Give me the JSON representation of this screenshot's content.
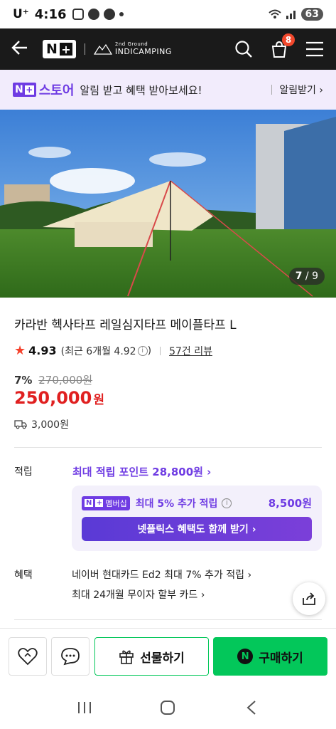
{
  "status_bar": {
    "carrier": "U⁺",
    "time": "4:16",
    "battery": "63"
  },
  "header": {
    "back_icon": "arrow-left-icon",
    "logo_n": "N",
    "logo_plus": "+",
    "brand_small": "2nd Ground",
    "brand_name": "INDICAMPING",
    "cart_count": "8"
  },
  "banner": {
    "store_label": "스토어",
    "text": "알림 받고 혜택 받아보세요!",
    "action": "알림받기 ›"
  },
  "hero": {
    "counter_current": "7",
    "counter_total": "/ 9"
  },
  "product": {
    "title": "카라반 헥사타프 레일심지타프 메이플타프 L",
    "rating": "4.93",
    "recent_rating": "(최근 6개월 4.92",
    "recent_close": ")",
    "reviews": "57건 리뷰",
    "discount_pct": "7%",
    "original_price": "270,000원",
    "price": "250,000",
    "price_unit": "원",
    "shipping": "3,000원"
  },
  "points": {
    "label": "적립",
    "max_text": "최대 적립 포인트 28,800원 ›",
    "membership_badge": "멤버십",
    "extra_text": "최대 5% 추가 적립",
    "extra_amount": "8,500원",
    "netflix_button": "넷플릭스 혜택도 함께 받기 ›"
  },
  "benefits": {
    "label": "혜택",
    "line1": "네이버 현대카드 Ed2 최대 7% 추가 적립 ›",
    "line2": "최대 24개월 무이자 할부 카드 ›"
  },
  "actions": {
    "gift_label": "선물하기",
    "buy_label": "구매하기",
    "buy_n": "N"
  },
  "colors": {
    "accent_purple": "#6f3ce3",
    "naver_green": "#03c75a",
    "price_red": "#e02020"
  }
}
